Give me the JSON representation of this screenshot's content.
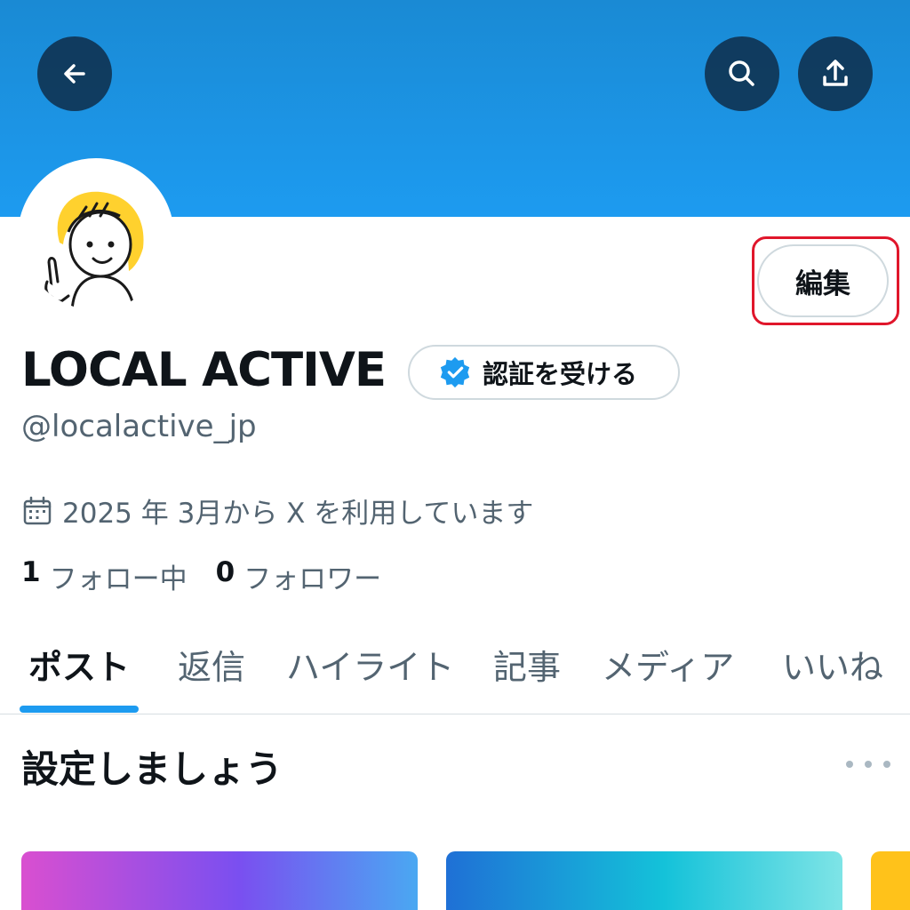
{
  "colors": {
    "accent": "#1d9bf0",
    "highlight": "#e0162b",
    "text_primary": "#0f1419",
    "text_secondary": "#536471"
  },
  "header": {
    "back_icon": "arrow-left-icon",
    "search_icon": "search-icon",
    "share_icon": "share-icon"
  },
  "profile": {
    "avatar_icon": "cartoon-avatar-icon",
    "edit_label": "編集",
    "display_name": "LOCAL ACTIVE",
    "verify_label": "認証を受ける",
    "verify_icon": "verified-badge-icon",
    "handle": "@localactive_jp",
    "joined_icon": "calendar-icon",
    "joined_text": "2025 年 3月から X を利用しています",
    "following_count": "1",
    "following_label": "フォロー中",
    "followers_count": "0",
    "followers_label": "フォロワー"
  },
  "tabs": [
    {
      "label": "ポスト",
      "active": true
    },
    {
      "label": "返信",
      "active": false
    },
    {
      "label": "ハイライト",
      "active": false
    },
    {
      "label": "記事",
      "active": false
    },
    {
      "label": "メディア",
      "active": false
    },
    {
      "label": "いいね",
      "active": false
    }
  ],
  "setup": {
    "title": "設定しましょう",
    "more_icon": "more-horizontal-icon"
  }
}
